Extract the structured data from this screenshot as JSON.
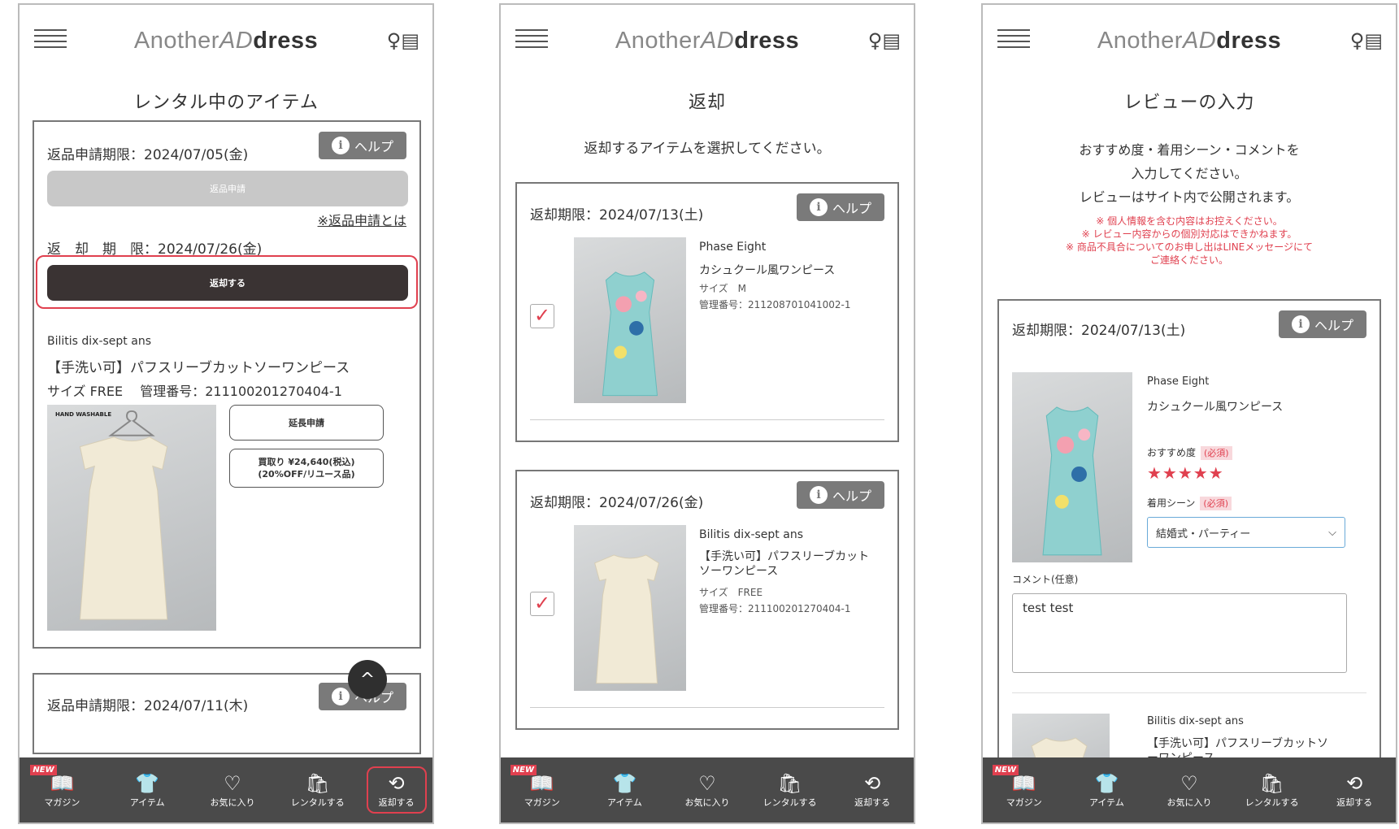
{
  "brand": {
    "logo_a": "Another",
    "logo_b": "AD",
    "logo_c": "dress"
  },
  "screen1": {
    "title": "レンタル中のアイテム",
    "apply_deadline": "返品申請期限：2024/07/05(金)",
    "help": "ヘルプ",
    "apply_btn": "返品申請",
    "apply_link": "※返品申請とは",
    "return_deadline": "返　却　期　限：2024/07/26(金)",
    "return_btn": "返却する",
    "brand_name": "Bilitis dix-sept ans",
    "item_name": "【手洗い可】パフスリーブカットソーワンピース",
    "size_mgmt": "サイズ FREE　 管理番号：211100201270404-1",
    "hand_washable": "HAND WASHABLE",
    "extend_btn": "延長申請",
    "buy_btn_1": "買取り ¥24,640(税込)",
    "buy_btn_2": "(20%OFF/リユース品)",
    "next_deadline": "返品申請期限：2024/07/11(木)",
    "fab": "^"
  },
  "screen2": {
    "title": "返却",
    "instruction": "返却するアイテムを選択してください。",
    "help": "ヘルプ",
    "items": [
      {
        "deadline": "返却期限：2024/07/13(土)",
        "brand": "Phase Eight",
        "name": "カシュクール風ワンピース",
        "size": "サイズ　M",
        "mgmt": "管理番号：211208701041002-1",
        "checked": "✓"
      },
      {
        "deadline": "返却期限：2024/07/26(金)",
        "brand": "Bilitis dix-sept ans",
        "name": "【手洗い可】パフスリーブカットソーワンピース",
        "size": "サイズ　FREE",
        "mgmt": "管理番号：211100201270404-1",
        "checked": "✓"
      }
    ]
  },
  "screen3": {
    "title": "レビューの入力",
    "intro_1": "おすすめ度・着用シーン・コメントを",
    "intro_2": "入力してください。",
    "intro_3": "レビューはサイト内で公開されます。",
    "note_1": "※ 個人情報を含む内容はお控えください。",
    "note_2": "※ レビュー内容からの個別対応はできかねます。",
    "note_3": "※ 商品不具合についてのお申し出はLINEメッセージにて",
    "note_4": "ご連絡ください。",
    "deadline": "返却期限：2024/07/13(土)",
    "help": "ヘルプ",
    "brand": "Phase Eight",
    "name": "カシュクール風ワンピース",
    "rec_label": "おすすめ度",
    "required": "(必須)",
    "stars": "★★★★★",
    "rating": 5,
    "scene_label": "着用シーン",
    "scene_value": "結婚式・パーティー",
    "comment_label": "コメント(任意)",
    "comment_value": "test test",
    "brand2": "Bilitis dix-sept ans",
    "name2": "【手洗い可】パフスリーブカットソーワンピース"
  },
  "nav": {
    "new": "NEW",
    "magazine": "マガジン",
    "items": "アイテム",
    "favorites": "お気に入り",
    "rent": "レンタルする",
    "return": "返却する"
  }
}
